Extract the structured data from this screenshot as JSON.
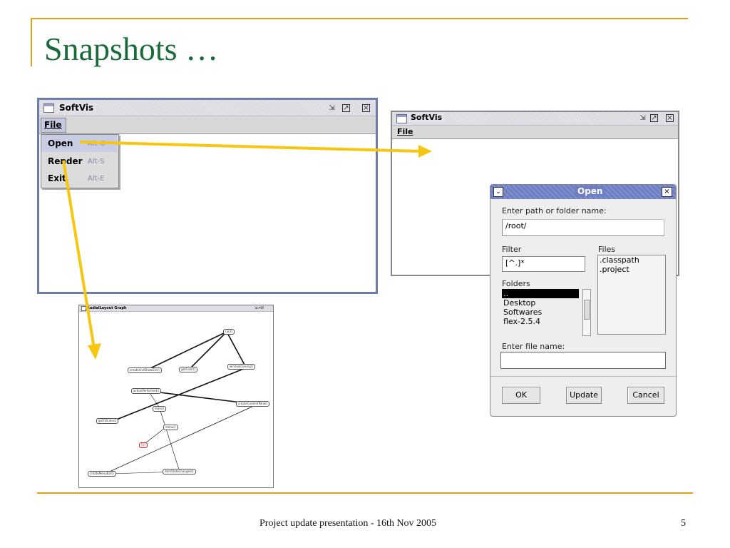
{
  "slide": {
    "title": "Snapshots …",
    "footer": "Project update presentation - 16th Nov 2005",
    "page_number": "5",
    "accent_color": "#e0a01c",
    "title_color": "#1a6b3a"
  },
  "window1": {
    "title": "SoftVis",
    "menu_file": "File",
    "menu_items": [
      {
        "label": "Open",
        "shortcut": "Alt-O"
      },
      {
        "label": "Render",
        "shortcut": "Alt-S"
      },
      {
        "label": "Exit",
        "shortcut": "Alt-E"
      }
    ]
  },
  "window2": {
    "title": "SoftVis",
    "menu_file": "File"
  },
  "graph_window": {
    "title": "RadialLayout Graph",
    "nodes": [
      "run()",
      "createAndShowGUI()",
      "getColor()",
      "windowClosing()",
      "actionPerformed()",
      "createContentPane()",
      "main()",
      "menu()",
      "getFillColor()",
      "[3]",
      "createMenuBar()",
      "itemStateChanged()"
    ]
  },
  "open_dialog": {
    "title": "Open",
    "path_label": "Enter path or folder name:",
    "path_value": "/root/",
    "filter_label": "Filter",
    "filter_value": "[^.]*",
    "files_label": "Files",
    "files": [
      ".classpath",
      ".project"
    ],
    "folders_label": "Folders",
    "folders": [
      "..",
      "Desktop",
      "Softwares",
      "flex-2.5.4"
    ],
    "filename_label": "Enter file name:",
    "filename_value": "",
    "ok_label": "OK",
    "update_label": "Update",
    "cancel_label": "Cancel"
  },
  "icons": {
    "window_icon": "window-icon",
    "minimize": "minimize-icon",
    "maximize": "maximize-icon",
    "close": "close-icon"
  }
}
